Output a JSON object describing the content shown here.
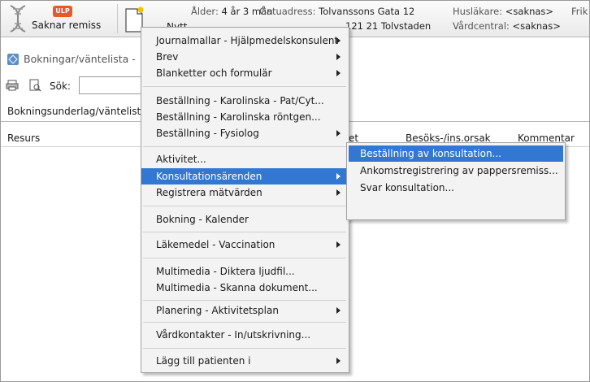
{
  "header": {
    "ulp_badge": "ULP",
    "saknar_remiss": "Saknar remiss",
    "nytt": "Nytt",
    "alder_label": "Ålder:",
    "alder_value": "4 år 3 mån",
    "gatuadress_label": "Gatuadress:",
    "gatuadress_value": "Tolvanssons Gata 12",
    "postort": "121 21 Tolvstaden",
    "huslakare_label": "Husläkare:",
    "huslakare_value": "<saknas>",
    "vardcentral_label": "Vårdcentral:",
    "vardcentral_value": "<saknas>",
    "truncated": "Frik"
  },
  "booking_title": "Bokningar/väntelista -",
  "toolbar": {
    "sok_label": "Sök:",
    "sok_value": ""
  },
  "tab_label": "Bokningsunderlag/väntelista",
  "columns": {
    "resurs": "Resurs",
    "partial": "et",
    "besok": "Besöks-/ins.orsak",
    "kommentar": "Kommentar"
  },
  "menu": {
    "items": [
      {
        "label": "Journalmallar - Hjälpmedelskonsulent",
        "submenu": true
      },
      {
        "label": "Brev",
        "submenu": true
      },
      {
        "label": "Blanketter och formulär",
        "submenu": true
      },
      {
        "label": "Beställning - Karolinska - Pat/Cyt...",
        "submenu": false
      },
      {
        "label": "Beställning - Karolinska röntgen...",
        "submenu": false
      },
      {
        "label": "Beställning - Fysiolog",
        "submenu": true
      },
      {
        "label": "Aktivitet...",
        "submenu": false
      },
      {
        "label": "Konsultationsärenden",
        "submenu": true,
        "highlighted": true
      },
      {
        "label": "Registrera mätvärden",
        "submenu": true
      },
      {
        "label": "Bokning - Kalender",
        "submenu": false
      },
      {
        "label": "Läkemedel - Vaccination",
        "submenu": true
      },
      {
        "label": "Multimedia - Diktera ljudfil...",
        "submenu": false
      },
      {
        "label": "Multimedia - Skanna dokument...",
        "submenu": false
      },
      {
        "label": "Planering - Aktivitetsplan",
        "submenu": true
      },
      {
        "label": "Vårdkontakter - In/utskrivning...",
        "submenu": false
      },
      {
        "label": "Lägg till patienten i",
        "submenu": true
      }
    ]
  },
  "submenu": {
    "items": [
      {
        "label": "Beställning av konsultation...",
        "highlighted": true
      },
      {
        "label": "Ankomstregistrering av pappersremiss..."
      },
      {
        "label": "Svar konsultation..."
      }
    ]
  }
}
